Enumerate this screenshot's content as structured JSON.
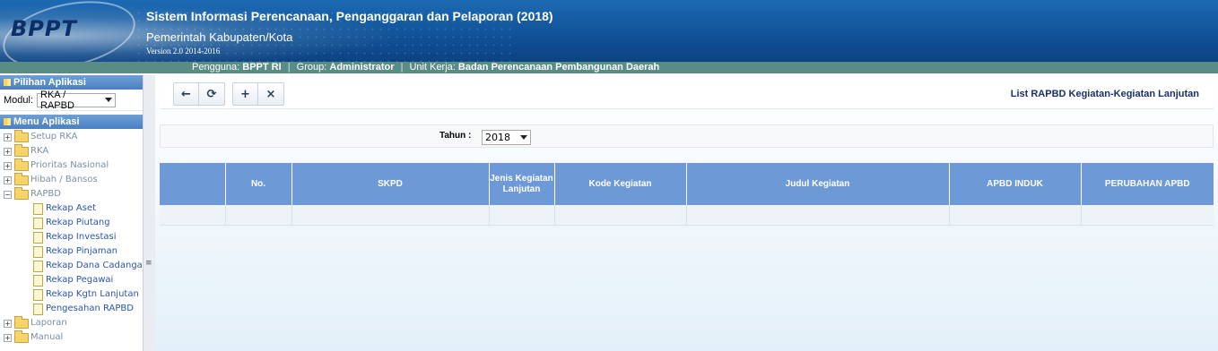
{
  "header": {
    "logo_text": "BPPT",
    "title": "Sistem Informasi Perencanaan, Penganggaran dan Pelaporan (2018)",
    "subtitle": "Pemerintah Kabupaten/Kota",
    "version": "Version 2.0 2014-2016",
    "user_label": "Pengguna:",
    "user_value": "BPPT RI",
    "group_label": "Group:",
    "group_value": "Administrator",
    "unit_label": "Unit Kerja:",
    "unit_value": "Badan Perencanaan Pembangunan Daerah"
  },
  "sidebar": {
    "pilihan_title": "Pilihan Aplikasi",
    "modul_label": "Modul:",
    "modul_value": "RKA / RAPBD",
    "menu_title": "Menu Aplikasi",
    "items": [
      {
        "label": "Setup RKA"
      },
      {
        "label": "RKA"
      },
      {
        "label": "Prioritas Nasional"
      },
      {
        "label": "Hibah / Bansos"
      },
      {
        "label": "RAPBD"
      },
      {
        "label": "Rekap Aset"
      },
      {
        "label": "Rekap Piutang"
      },
      {
        "label": "Rekap Investasi"
      },
      {
        "label": "Rekap Pinjaman"
      },
      {
        "label": "Rekap Dana Cadanga"
      },
      {
        "label": "Rekap Pegawai"
      },
      {
        "label": "Rekap Kgtn Lanjutan"
      },
      {
        "label": "Pengesahan RAPBD"
      },
      {
        "label": "Laporan"
      },
      {
        "label": "Manual"
      }
    ]
  },
  "toolbar": {
    "back_icon": "←",
    "refresh_icon": "⟳",
    "add_icon": "+",
    "delete_icon": "×",
    "heading": "List RAPBD Kegiatan-Kegiatan Lanjutan"
  },
  "filter": {
    "tahun_label": "Tahun :",
    "tahun_value": "2018"
  },
  "table": {
    "columns": [
      "",
      "No.",
      "SKPD",
      "Jenis Kegiatan Lanjutan",
      "Kode Kegiatan",
      "Judul Kegiatan",
      "APBD INDUK",
      "PERUBAHAN APBD"
    ]
  },
  "colors": {
    "header_blue": "#0f4f93",
    "userbar": "#5a8c86",
    "table_header": "#6d9ad6",
    "heading_text": "#1b2f6b"
  }
}
